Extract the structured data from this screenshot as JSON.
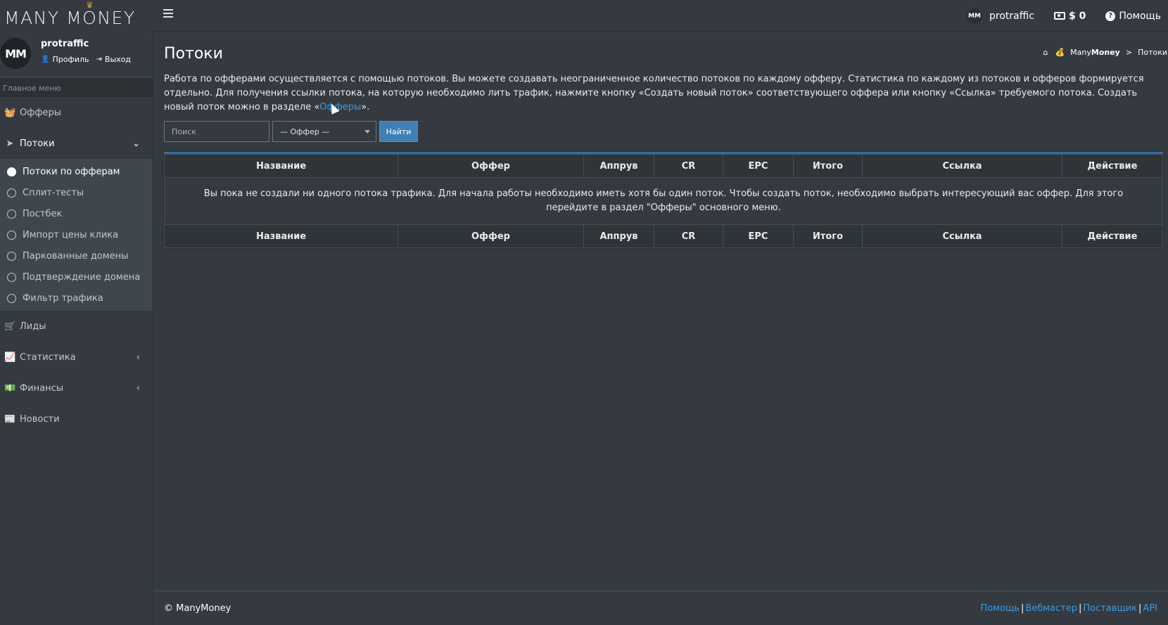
{
  "brand": {
    "logo_text": "MANY MONEY",
    "crown": "♛"
  },
  "topbar": {
    "username": "protraffic",
    "avatar_text": "MM",
    "balance": "$ 0",
    "help_label": "Помощь"
  },
  "sidebar": {
    "user": {
      "name": "protraffic",
      "avatar_text": "MM",
      "profile_label": "Профиль",
      "logout_label": "Выход"
    },
    "header": "Главное меню",
    "items": [
      {
        "label": "Офферы",
        "icon": "basket-icon"
      },
      {
        "label": "Потоки",
        "icon": "paper-plane-icon",
        "open": true,
        "children": [
          {
            "label": "Потоки по офферам",
            "active": true
          },
          {
            "label": "Сплит-тесты"
          },
          {
            "label": "Постбек"
          },
          {
            "label": "Импорт цены клика"
          },
          {
            "label": "Паркованные домены"
          },
          {
            "label": "Подтверждение домена"
          },
          {
            "label": "Фильтр трафика"
          }
        ]
      },
      {
        "label": "Лиды",
        "icon": "cart-icon"
      },
      {
        "label": "Статистика",
        "icon": "chart-area-icon"
      },
      {
        "label": "Финансы",
        "icon": "money-icon"
      },
      {
        "label": "Новости",
        "icon": "newspaper-icon"
      }
    ]
  },
  "page": {
    "title": "Потоки",
    "breadcrumb": {
      "brand_prefix": "Many",
      "brand_bold": "Money",
      "separator": ">",
      "current": "Потоки"
    },
    "intro_text": "Работа по офферами осуществляется с помощью потоков. Вы можете создавать неограниченное количество потоков по каждому офферу. Статистика по каждому из потоков и офферов формируется отдельно. Для получения ссылки потока, на которую необходимо лить трафик, нажмите кнопку «Создать новый поток» соответствующего оффера или кнопку «Ссылка» требуемого потока. Создать новый поток можно в разделе «",
    "intro_link": "Офферы",
    "intro_tail": "»."
  },
  "filters": {
    "search_placeholder": "Поиск",
    "offer_select": "— Оффер —",
    "find_label": "Найти"
  },
  "table": {
    "columns": [
      "Название",
      "Оффер",
      "Аппрув",
      "CR",
      "EPC",
      "Итого",
      "Ссылка",
      "Действие"
    ],
    "empty_message": "Вы пока не создали ни одного потока трафика. Для начала работы необходимо иметь хотя бы один поток. Чтобы создать поток, необходимо выбрать интересующий вас оффер. Для этого перейдите в раздел \"Офферы\" основного меню."
  },
  "footer": {
    "copyright": "© ManyMoney",
    "links": [
      "Помощь",
      "Вебмастер",
      "Поставщик",
      "API"
    ]
  }
}
